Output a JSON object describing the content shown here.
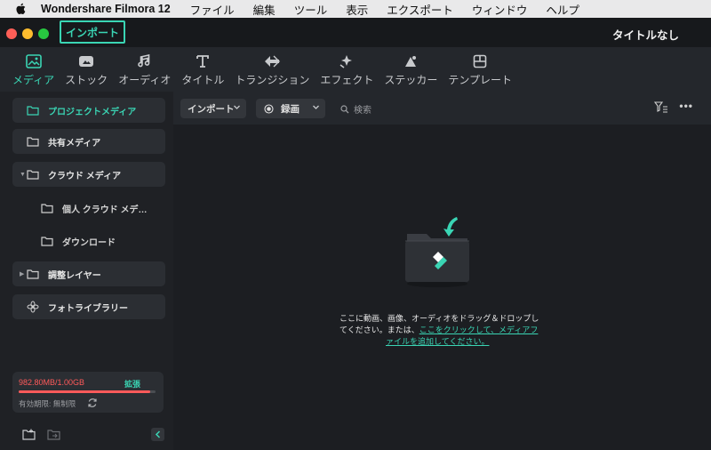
{
  "menubar": {
    "app_name": "Wondershare Filmora 12",
    "items": [
      "ファイル",
      "編集",
      "ツール",
      "表示",
      "エクスポート",
      "ウィンドウ",
      "ヘルプ"
    ]
  },
  "titlebar": {
    "import_tab": "インポート",
    "document_title": "タイトルなし"
  },
  "toolbar": {
    "tabs": [
      {
        "label": "メディア",
        "icon": "media-icon",
        "active": true
      },
      {
        "label": "ストック",
        "icon": "stock-icon",
        "active": false
      },
      {
        "label": "オーディオ",
        "icon": "music-note-icon",
        "active": false
      },
      {
        "label": "タイトル",
        "icon": "title-t-icon",
        "active": false
      },
      {
        "label": "トランジション",
        "icon": "transition-icon",
        "active": false
      },
      {
        "label": "エフェクト",
        "icon": "effects-sparkle-icon",
        "active": false
      },
      {
        "label": "ステッカー",
        "icon": "sticker-icon",
        "active": false
      },
      {
        "label": "テンプレート",
        "icon": "template-icon",
        "active": false
      }
    ]
  },
  "sidebar": {
    "items": [
      {
        "label": "プロジェクトメディア",
        "active": true
      },
      {
        "label": "共有メディア"
      },
      {
        "label": "クラウド メディア"
      },
      {
        "label": "個人 クラウド メデ…"
      },
      {
        "label": "ダウンロード"
      },
      {
        "label": "調整レイヤー"
      },
      {
        "label": "フォトライブラリー"
      }
    ],
    "storage": {
      "usage": "982.80MB/1.00GB",
      "expand_label": "拡張",
      "used_fraction": 0.96,
      "expiry": "有効期限: 無制限"
    }
  },
  "content": {
    "import_dropdown": "インポート",
    "record_dropdown": "録画",
    "search_placeholder": "検索",
    "empty": {
      "line1": "ここに動画、画像、オーディオをドラッグ＆ドロップし",
      "line2_prefix": "てください。または、",
      "link_part1": "ここをクリックして、メディアフ",
      "link_part2": "ァイルを追加してください。"
    }
  },
  "colors": {
    "accent": "#3ad5b4",
    "warning": "#ff5a5a"
  }
}
